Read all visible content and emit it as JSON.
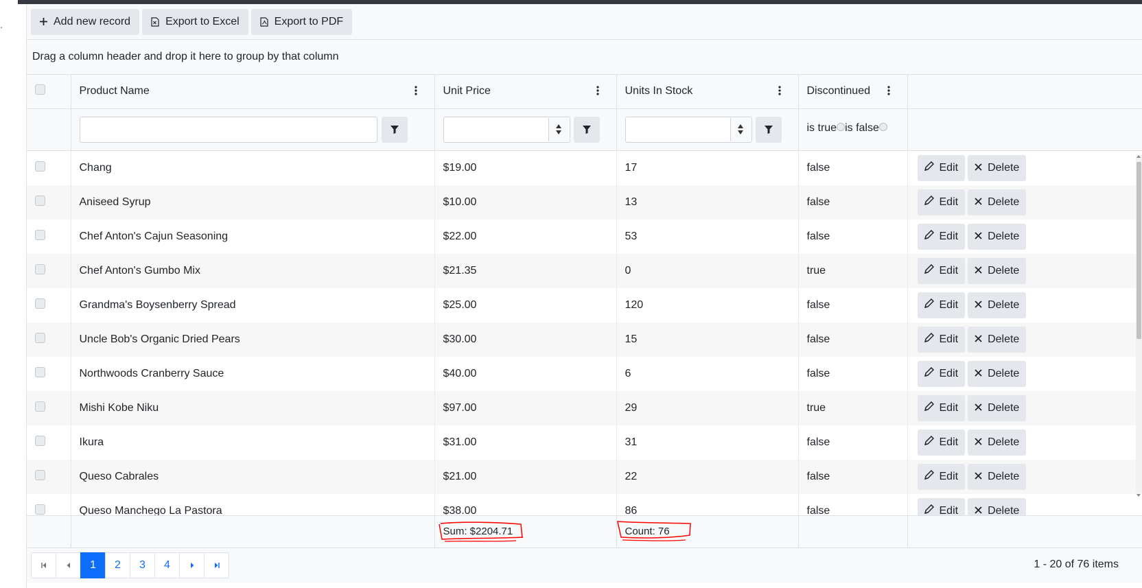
{
  "stray_text": ".",
  "toolbar": {
    "add_label": "Add new record",
    "excel_label": "Export to Excel",
    "pdf_label": "Export to PDF"
  },
  "group_hint": "Drag a column header and drop it here to group by that column",
  "columns": {
    "product_name": "Product Name",
    "unit_price": "Unit Price",
    "units_in_stock": "Units In Stock",
    "discontinued": "Discontinued"
  },
  "filters": {
    "product_name_value": "",
    "unit_price_value": "",
    "units_in_stock_value": "",
    "is_true": "is true",
    "is_false": "is false"
  },
  "rows": [
    {
      "name": "Chang",
      "price": "$19.00",
      "stock": "17",
      "disc": "false"
    },
    {
      "name": "Aniseed Syrup",
      "price": "$10.00",
      "stock": "13",
      "disc": "false"
    },
    {
      "name": "Chef Anton's Cajun Seasoning",
      "price": "$22.00",
      "stock": "53",
      "disc": "false"
    },
    {
      "name": "Chef Anton's Gumbo Mix",
      "price": "$21.35",
      "stock": "0",
      "disc": "true"
    },
    {
      "name": "Grandma's Boysenberry Spread",
      "price": "$25.00",
      "stock": "120",
      "disc": "false"
    },
    {
      "name": "Uncle Bob's Organic Dried Pears",
      "price": "$30.00",
      "stock": "15",
      "disc": "false"
    },
    {
      "name": "Northwoods Cranberry Sauce",
      "price": "$40.00",
      "stock": "6",
      "disc": "false"
    },
    {
      "name": "Mishi Kobe Niku",
      "price": "$97.00",
      "stock": "29",
      "disc": "true"
    },
    {
      "name": "Ikura",
      "price": "$31.00",
      "stock": "31",
      "disc": "false"
    },
    {
      "name": "Queso Cabrales",
      "price": "$21.00",
      "stock": "22",
      "disc": "false"
    },
    {
      "name": "Queso Manchego La Pastora",
      "price": "$38.00",
      "stock": "86",
      "disc": "false"
    }
  ],
  "commands": {
    "edit": "Edit",
    "delete": "Delete"
  },
  "footer": {
    "sum": "Sum: $2204.71",
    "count": "Count: 76"
  },
  "pager": {
    "pages": [
      "1",
      "2",
      "3",
      "4"
    ],
    "active_page": "1",
    "info": "1 - 20 of 76 items"
  },
  "colors": {
    "accent": "#0d6efd",
    "annotation": "#ff0000",
    "topbar": "#343a40"
  }
}
